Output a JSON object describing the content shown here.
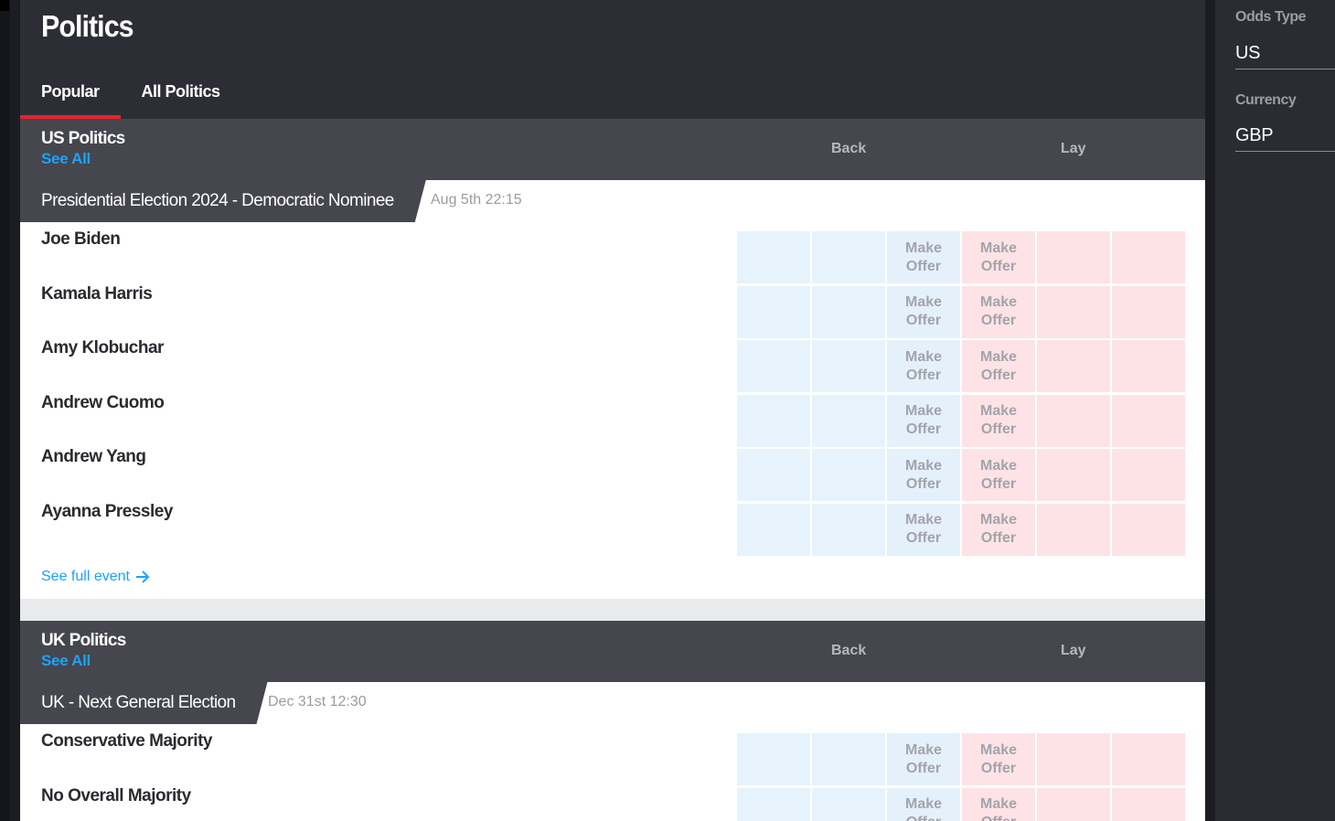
{
  "page": {
    "title": "Politics"
  },
  "tabs": [
    {
      "label": "Popular"
    },
    {
      "label": "All Politics"
    }
  ],
  "colors": {
    "accent": "#e8212d",
    "link": "#1aa3ff",
    "back": "#e6f3fc",
    "lay": "#fde3e6"
  },
  "sections": [
    {
      "title": "US Politics",
      "see_all": "See All",
      "back_label": "Back",
      "lay_label": "Lay",
      "event": {
        "name": "Presidential Election 2024 - Democratic Nominee",
        "date": "Aug 5th 22:15"
      },
      "runners": [
        "Joe Biden",
        "Kamala Harris",
        "Amy Klobuchar",
        "Andrew Cuomo",
        "Andrew Yang",
        "Ayanna Pressley"
      ],
      "see_full": "See full event"
    },
    {
      "title": "UK Politics",
      "see_all": "See All",
      "back_label": "Back",
      "lay_label": "Lay",
      "event": {
        "name": "UK - Next General Election",
        "date": "Dec 31st 12:30"
      },
      "runners": [
        "Conservative Majority",
        "No Overall Majority"
      ]
    }
  ],
  "offer": {
    "line1": "Make",
    "line2": "Offer"
  },
  "settings": {
    "odds_type_label": "Odds Type",
    "odds_type_value": "US",
    "currency_label": "Currency",
    "currency_value": "GBP"
  }
}
